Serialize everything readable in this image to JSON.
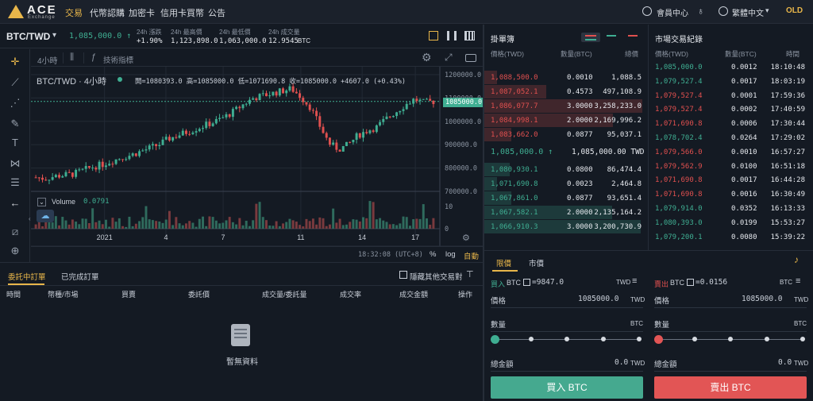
{
  "brand": {
    "name": "ACE",
    "sub": "Exchange"
  },
  "nav": {
    "items": [
      "交易",
      "代幣認購",
      "加密卡",
      "信用卡買幣",
      "公告"
    ]
  },
  "topright": {
    "member": "會員中心",
    "lang": "繁體中文",
    "currency": "OLD"
  },
  "ticker": {
    "pair": "BTC/TWD",
    "last": "1,085,000.0 ↑",
    "change_label": "24h 漲跌",
    "change_val": "+1.90%",
    "high_label": "24h 最高價",
    "high_val": "1,123,898.0",
    "low_label": "24h 最低價",
    "low_val": "1,063,000.0",
    "vol_label": "24h 成交量",
    "vol_val": "12.9545",
    "vol_unit": "BTC"
  },
  "chart_toolbar": {
    "interval": "4小時",
    "indicators": "技術指標"
  },
  "chart": {
    "legend_title": "BTC/TWD · 4小時",
    "ohlc": "開=1080393.0 高=1085000.0 低=1071690.8 收=1085000.0 +4607.0 (+0.43%)",
    "price_tag": "1085000.0",
    "volume_label": "Volume",
    "volume_val": "0.0791",
    "time": "18:32:08 (UTC+8)",
    "pct": "%",
    "log": "log",
    "auto": "自動"
  },
  "chart_data": {
    "type": "candlestick",
    "y_ticks": [
      "1200000.0",
      "1100000.0",
      "1000000.0",
      "900000.0",
      "800000.0",
      "700000.0"
    ],
    "ylim": [
      700000,
      1200000
    ],
    "x_ticks": [
      "2021",
      "4",
      "7",
      "11",
      "14",
      "17"
    ],
    "volume_ticks": [
      "10",
      "0"
    ],
    "close_series": [
      760000,
      755000,
      765000,
      770000,
      775000,
      790000,
      805000,
      815000,
      830000,
      845000,
      855000,
      870000,
      885000,
      900000,
      925000,
      940000,
      955000,
      970000,
      985000,
      1000000,
      1020000,
      1045000,
      1075000,
      1100000,
      1110000,
      1120000,
      1130000,
      1140000,
      1105000,
      1060000,
      980000,
      905000,
      880000,
      900000,
      940000,
      960000,
      975000,
      1010000,
      1040000,
      1070000,
      1095000,
      1080000,
      1085000
    ]
  },
  "order_book": {
    "title": "掛單簿",
    "headers": [
      "價格(TWD)",
      "數量(BTC)",
      "總價"
    ],
    "asks": [
      [
        "1,088,500.0",
        "0.0010",
        "1,088.5"
      ],
      [
        "1,087,052.1",
        "0.4573",
        "497,108.9"
      ],
      [
        "1,086,077.7",
        "3.0000",
        "3,258,233.0"
      ],
      [
        "1,084,998.1",
        "2.0000",
        "2,169,996.2"
      ],
      [
        "1,083,662.0",
        "0.0877",
        "95,037.1"
      ]
    ],
    "mid": "1,085,000.0 ↑",
    "mid_twd": "1,085,000.00 TWD",
    "bids": [
      [
        "1,080,930.1",
        "0.0800",
        "86,474.4"
      ],
      [
        "1,071,690.8",
        "0.0023",
        "2,464.8"
      ],
      [
        "1,067,861.0",
        "0.0877",
        "93,651.4"
      ],
      [
        "1,067,582.1",
        "2.0000",
        "2,135,164.2"
      ],
      [
        "1,066,910.3",
        "3.0000",
        "3,200,730.9"
      ]
    ]
  },
  "trades": {
    "title": "市場交易紀錄",
    "headers": [
      "價格(TWD)",
      "數量(BTC)",
      "時間"
    ],
    "rows": [
      [
        "1,085,000.0",
        "0.0012",
        "18:10:48",
        "g"
      ],
      [
        "1,079,527.4",
        "0.0017",
        "18:03:19",
        "g"
      ],
      [
        "1,079,527.4",
        "0.0001",
        "17:59:36",
        "r"
      ],
      [
        "1,079,527.4",
        "0.0002",
        "17:40:59",
        "r"
      ],
      [
        "1,071,690.8",
        "0.0006",
        "17:30:44",
        "r"
      ],
      [
        "1,078,702.4",
        "0.0264",
        "17:29:02",
        "g"
      ],
      [
        "1,079,566.0",
        "0.0010",
        "16:57:27",
        "r"
      ],
      [
        "1,079,562.9",
        "0.0100",
        "16:51:18",
        "r"
      ],
      [
        "1,071,690.8",
        "0.0017",
        "16:44:28",
        "r"
      ],
      [
        "1,071,690.8",
        "0.0016",
        "16:30:49",
        "r"
      ],
      [
        "1,079,914.0",
        "0.0352",
        "16:13:33",
        "g"
      ],
      [
        "1,080,393.0",
        "0.0199",
        "15:53:27",
        "g"
      ],
      [
        "1,079,200.1",
        "0.0080",
        "15:39:22",
        "g"
      ]
    ]
  },
  "orders": {
    "tab_open": "委託中訂單",
    "tab_done": "已完成訂單",
    "hide_other": "隱藏其他交易對",
    "headers": [
      "時間",
      "幣種/市場",
      "買賣",
      "委託價",
      "成交量/委託量",
      "成交率",
      "成交金額",
      "操作"
    ],
    "empty": "暫無資料"
  },
  "trade_panel": {
    "tab_limit": "限價",
    "tab_market": "市價",
    "buy": {
      "label": "買入",
      "asset": "BTC",
      "avail": "=9847.0",
      "unit": "TWD",
      "price_label": "價格",
      "price": "1085000.0",
      "price_unit": "TWD",
      "qty_label": "數量",
      "qty_unit": "BTC",
      "total_label": "總金額",
      "total": "0.0",
      "total_unit": "TWD",
      "button": "買入 BTC"
    },
    "sell": {
      "label": "賣出",
      "asset": "BTC",
      "avail": "=0.0156",
      "unit": "BTC",
      "price_label": "價格",
      "price": "1085000.0",
      "price_unit": "TWD",
      "qty_label": "數量",
      "qty_unit": "BTC",
      "total_label": "總金額",
      "total": "0.0",
      "total_unit": "TWD",
      "button": "賣出 BTC"
    }
  }
}
